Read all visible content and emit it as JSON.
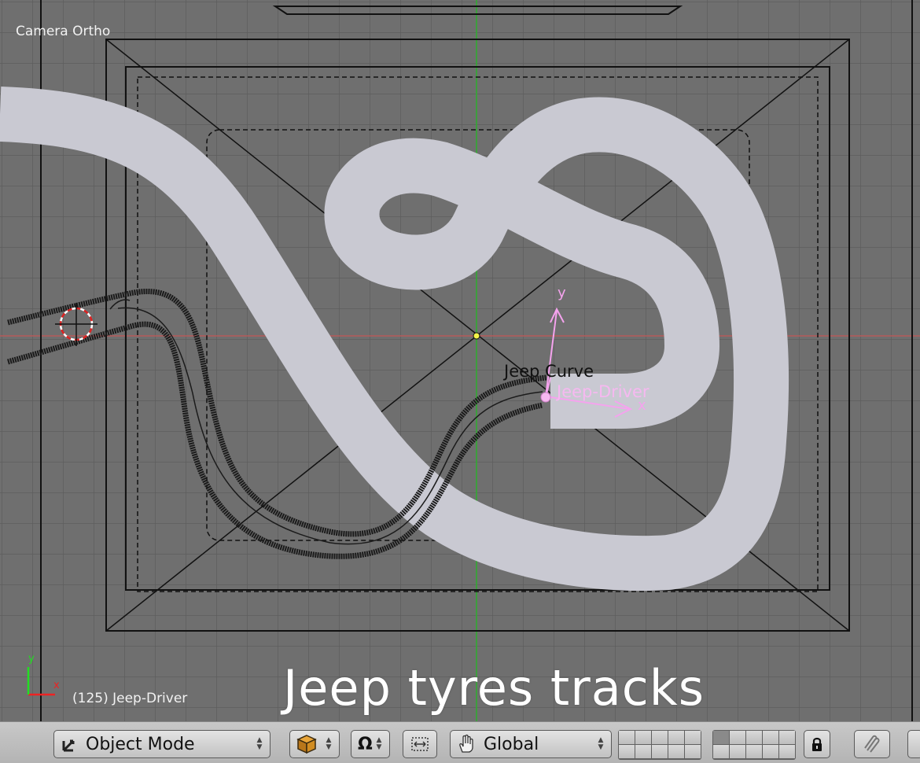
{
  "viewport": {
    "camera_label": "Camera Ortho",
    "frame_label": "(125) Jeep-Driver",
    "overlay_title": "Jeep tyres tracks",
    "curve_object_label": "Jeep Curve",
    "driver_object_label": "Jeep-Driver",
    "axis_labels": {
      "x": "x",
      "y": "y"
    },
    "corner_axis_labels": {
      "x": "x",
      "y": "y"
    },
    "colors": {
      "background": "#6f6f6f",
      "grid": "#5d5d5d",
      "road": "#c9c9d2",
      "selection": "#f6b8f0",
      "x_axis": "#b55a5a",
      "y_axis": "#2fae2f"
    }
  },
  "header": {
    "mode_menu": {
      "label": "Object Mode",
      "icon": "object-mode-icon"
    },
    "draw_type_icon": "cube-icon",
    "pivot_icon": "pivot-omega-icon",
    "manipulator_icon": "manipulator-icon",
    "transform_orientation": {
      "label": "Global",
      "icon": "hand-icon"
    },
    "lock_icon": "lock-icon",
    "snap_icon": "magnet-icon"
  }
}
